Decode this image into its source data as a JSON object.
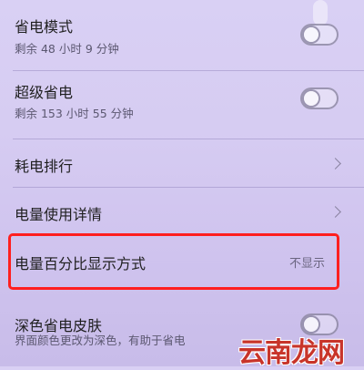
{
  "settings": {
    "power_saving": {
      "title": "省电模式",
      "subtitle": "剩余 48 小时 9 分钟",
      "enabled": false
    },
    "ultra_power_saving": {
      "title": "超级省电",
      "subtitle": "剩余 153 小时 55 分钟",
      "enabled": false
    },
    "power_ranking": {
      "title": "耗电排行"
    },
    "usage_details": {
      "title": "电量使用详情"
    },
    "percentage_display": {
      "title": "电量百分比显示方式",
      "value": "不显示"
    },
    "dark_skin": {
      "title": "深色省电皮肤",
      "subtitle": "界面颜色更改为深色，有助于省电",
      "enabled": false
    }
  },
  "highlight_color": "#ff1f1f",
  "watermark": "云南龙网"
}
